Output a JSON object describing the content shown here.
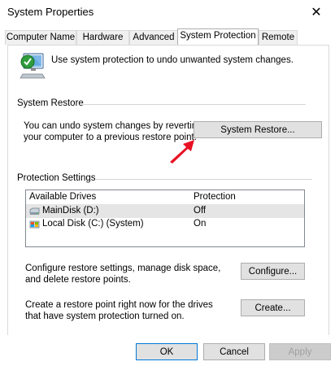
{
  "window": {
    "title": "System Properties",
    "close_symbol": "✕"
  },
  "tabs": [
    {
      "label": "Computer Name",
      "active": false
    },
    {
      "label": "Hardware",
      "active": false
    },
    {
      "label": "Advanced",
      "active": false
    },
    {
      "label": "System Protection",
      "active": true
    },
    {
      "label": "Remote",
      "active": false
    }
  ],
  "intro": {
    "text": "Use system protection to undo unwanted system changes.",
    "icon": "system-protection-icon"
  },
  "system_restore": {
    "group_label": "System Restore",
    "description_line1": "You can undo system changes by reverting",
    "description_line2": "your computer to a previous restore point.",
    "button_label": "System Restore..."
  },
  "protection_settings": {
    "group_label": "Protection Settings",
    "columns": [
      "Available Drives",
      "Protection"
    ],
    "drives": [
      {
        "name": "MainDisk (D:)",
        "protection": "Off",
        "icon": "disk-drive-icon"
      },
      {
        "name": "Local Disk (C:) (System)",
        "protection": "On",
        "icon": "system-drive-icon"
      }
    ],
    "configure_line1": "Configure restore settings, manage disk space,",
    "configure_line2": "and delete restore points.",
    "configure_button": "Configure...",
    "create_line1": "Create a restore point right now for the drives",
    "create_line2": "that have system protection turned on.",
    "create_button": "Create..."
  },
  "dialog_buttons": {
    "ok": "OK",
    "cancel": "Cancel",
    "apply": "Apply"
  },
  "colors": {
    "accent": "#0078d7",
    "annotation_arrow": "#e81123"
  }
}
